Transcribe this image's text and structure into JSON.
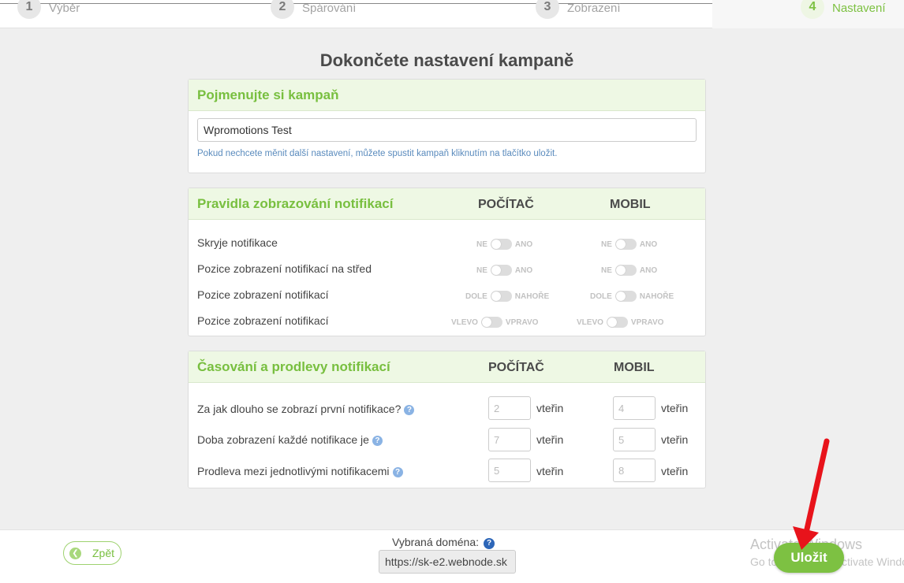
{
  "stepper": {
    "steps": [
      {
        "num": "1",
        "label": "Výběr"
      },
      {
        "num": "2",
        "label": "Spárování"
      },
      {
        "num": "3",
        "label": "Zobrazení"
      },
      {
        "num": "4",
        "label": "Nastavení"
      }
    ],
    "active_step": 4
  },
  "page_title": "Dokončete nastavení kampaně",
  "name_card": {
    "title": "Pojmenujte si kampaň",
    "input_value": "Wpromotions Test",
    "hint": "Pokud nechcete měnit další nastavení, můžete spustit kampaň kliknutím na tlačítko uložit."
  },
  "rules_card": {
    "title": "Pravidla zobrazování notifikací",
    "col_desktop": "POČÍTAČ",
    "col_mobile": "MOBIL",
    "rows": [
      {
        "label": "Skryje notifikace",
        "off": "NE",
        "on": "ANO"
      },
      {
        "label": "Pozice zobrazení notifikací na střed",
        "off": "NE",
        "on": "ANO"
      },
      {
        "label": "Pozice zobrazení notifikací",
        "off": "DOLE",
        "on": "NAHOŘE"
      },
      {
        "label": "Pozice zobrazení notifikací",
        "off": "VLEVO",
        "on": "VPRAVO"
      }
    ]
  },
  "timing_card": {
    "title": "Časování a prodlevy notifikací",
    "col_desktop": "POČÍTAČ",
    "col_mobile": "MOBIL",
    "unit": "vteřin",
    "help_glyph": "?",
    "rows": [
      {
        "label": "Za jak dlouho se zobrazí první notifikace?",
        "desktop": "2",
        "mobile": "4"
      },
      {
        "label": "Doba zobrazení každé notifikace je",
        "desktop": "7",
        "mobile": "5"
      },
      {
        "label": "Prodleva mezi jednotlivými notifikacemi",
        "desktop": "5",
        "mobile": "8"
      }
    ]
  },
  "footer": {
    "back_label": "Zpět",
    "domain_label": "Vybraná doména:",
    "domain_value": "https://sk-e2.webnode.sk",
    "save_label": "Uložit",
    "watermark_line1": "Activate Windows",
    "watermark_line2": "Go to Settings to activate Windows."
  },
  "colors": {
    "accent": "#7dc142",
    "header_bg": "#eef8e4",
    "annotation_arrow": "#e8131b"
  },
  "icons": {
    "back": "chevron-left-icon",
    "help": "question-circle-icon",
    "annotation": "red-arrow"
  }
}
